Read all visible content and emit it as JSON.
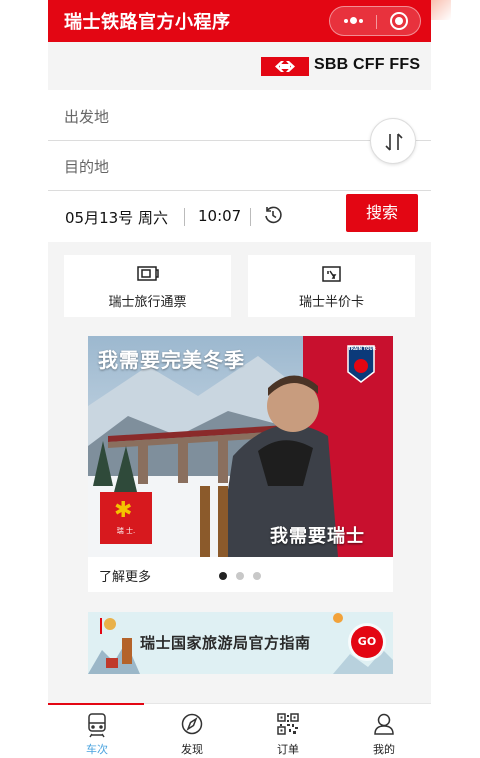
{
  "header": {
    "title": "瑞士铁路官方小程序",
    "menu_icon": "more-dots-icon",
    "close_icon": "capsule-close-icon"
  },
  "brand": {
    "logo_text": "SBB CFF FFS",
    "flag_color": "#e30613"
  },
  "search": {
    "from_placeholder": "出发地",
    "to_placeholder": "目的地",
    "date": "05月13号 周六",
    "time": "10:07",
    "button_label": "搜索"
  },
  "shortcuts": [
    {
      "label": "瑞士旅行通票",
      "icon": "ticket-icon"
    },
    {
      "label": "瑞士半价卡",
      "icon": "half-fare-card-icon"
    }
  ],
  "banner": {
    "title": "我需要完美冬季",
    "slogan": "我需要瑞士",
    "badge_text": "瑞 士.",
    "tour_badge": "TRAIN TOUR",
    "learn_more": "了解更多",
    "slides": 3,
    "active_slide": 1
  },
  "guide": {
    "text": "瑞士国家旅游局官方指南",
    "go_label": "GO"
  },
  "tabbar": {
    "items": [
      {
        "label": "车次",
        "icon": "train-icon",
        "active": true
      },
      {
        "label": "发现",
        "icon": "compass-icon",
        "active": false
      },
      {
        "label": "订单",
        "icon": "qr-code-icon",
        "active": false
      },
      {
        "label": "我的",
        "icon": "user-icon",
        "active": false
      }
    ]
  },
  "colors": {
    "accent": "#e30613",
    "tab_active": "#4aa3df",
    "background": "#f4f4f4"
  }
}
